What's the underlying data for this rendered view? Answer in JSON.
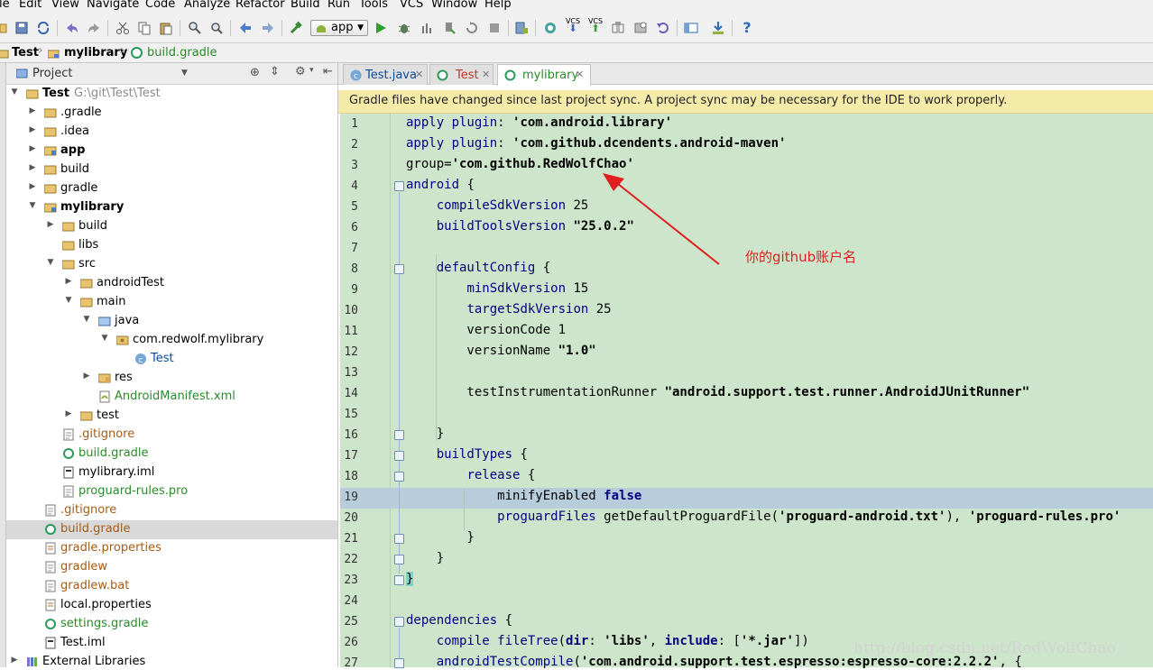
{
  "menu": [
    "le",
    "Edit",
    "View",
    "Navigate",
    "Code",
    "Analyze",
    "Refactor",
    "Build",
    "Run",
    "Tools",
    "VCS",
    "Window",
    "Help"
  ],
  "toolbar": {
    "run_config": "app",
    "vcs_label": "VCS",
    "help_icon": "?"
  },
  "breadcrumb": [
    "Test",
    "mylibrary",
    "build.gradle"
  ],
  "project_panel": {
    "title": "Project",
    "tree": [
      {
        "label": "Test",
        "path": "G:\\git\\Test\\Test",
        "icon": "folder-icon"
      },
      {
        "label": ".gradle",
        "icon": "folder-icon"
      },
      {
        "label": ".idea",
        "icon": "folder-icon"
      },
      {
        "label": "app",
        "icon": "module-folder-icon"
      },
      {
        "label": "build",
        "icon": "folder-icon"
      },
      {
        "label": "gradle",
        "icon": "folder-icon"
      },
      {
        "label": "mylibrary",
        "icon": "module-folder-icon"
      },
      {
        "label": "build",
        "icon": "folder-icon"
      },
      {
        "label": "libs",
        "icon": "folder-icon"
      },
      {
        "label": "src",
        "icon": "folder-icon"
      },
      {
        "label": "androidTest",
        "icon": "folder-icon"
      },
      {
        "label": "main",
        "icon": "folder-icon"
      },
      {
        "label": "java",
        "icon": "source-folder-icon"
      },
      {
        "label": "com.redwolf.mylibrary",
        "icon": "package-icon"
      },
      {
        "label": "Test",
        "icon": "class-icon"
      },
      {
        "label": "res",
        "icon": "resource-folder-icon"
      },
      {
        "label": "AndroidManifest.xml",
        "icon": "manifest-icon"
      },
      {
        "label": "test",
        "icon": "folder-icon"
      },
      {
        "label": ".gitignore",
        "icon": "file-icon"
      },
      {
        "label": "build.gradle",
        "icon": "gradle-icon"
      },
      {
        "label": "mylibrary.iml",
        "icon": "iml-icon"
      },
      {
        "label": "proguard-rules.pro",
        "icon": "file-icon"
      },
      {
        "label": ".gitignore",
        "icon": "file-icon"
      },
      {
        "label": "build.gradle",
        "icon": "gradle-icon"
      },
      {
        "label": "gradle.properties",
        "icon": "properties-icon"
      },
      {
        "label": "gradlew",
        "icon": "file-icon"
      },
      {
        "label": "gradlew.bat",
        "icon": "file-icon"
      },
      {
        "label": "local.properties",
        "icon": "properties-icon"
      },
      {
        "label": "settings.gradle",
        "icon": "gradle-icon"
      },
      {
        "label": "Test.iml",
        "icon": "iml-icon"
      },
      {
        "label": "External Libraries",
        "icon": "library-icon"
      }
    ]
  },
  "editor_tabs": [
    {
      "label": "Test.java",
      "active": false
    },
    {
      "label": "Test",
      "active": false
    },
    {
      "label": "mylibrary",
      "active": true
    }
  ],
  "notification": "Gradle files have changed since last project sync. A project sync may be necessary for the IDE to work properly.",
  "code_lines": [
    "1",
    "2",
    "3",
    "4",
    "5",
    "6",
    "7",
    "8",
    "9",
    "10",
    "11",
    "12",
    "13",
    "14",
    "15",
    "16",
    "17",
    "18",
    "19",
    "20",
    "21",
    "22",
    "23",
    "24",
    "25",
    "26",
    "27"
  ],
  "annotation": "你的github账户名",
  "watermark": "http://blog.csdn.net/RedWolfChao",
  "colors": {
    "editor_bg": "#cde6cb",
    "highlight_line": "#b8cddc",
    "notice_bg": "#f5eba9",
    "annotation": "#e02020"
  }
}
